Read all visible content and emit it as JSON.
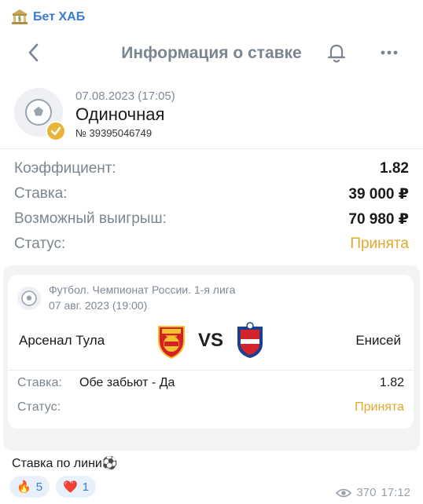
{
  "channel": {
    "name": "Бет ХАБ",
    "icon": "bank-icon"
  },
  "header": {
    "title": "Информация о ставке",
    "back_icon": "chevron-left-icon",
    "bell_icon": "bell-icon",
    "more_icon": "more-dots-icon"
  },
  "bet": {
    "date": "07.08.2023 (17:05)",
    "type": "Одиночная",
    "number": "№ 39395046749",
    "rows": [
      {
        "label": "Коэффициент:",
        "value": "1.82"
      },
      {
        "label": "Ставка:",
        "value": "39 000 ₽"
      },
      {
        "label": "Возможный выигрыш:",
        "value": "70 980 ₽"
      },
      {
        "label": "Статус:",
        "value": "Принята"
      }
    ]
  },
  "match": {
    "league": "Футбол. Чемпионат России. 1-я лига",
    "date": "07 авг. 2023 (19:00)",
    "team1": "Арсенал Тула",
    "vs": "VS",
    "team2": "Енисей",
    "stake_label": "Ставка:",
    "stake_value": "Обе забьют - Да",
    "stake_coef": "1.82",
    "status_label": "Статус:",
    "status_value": "Принята"
  },
  "post": {
    "caption": "Ставка по лини⚽",
    "reactions": [
      {
        "emoji": "🔥",
        "count": "5"
      },
      {
        "emoji": "❤️",
        "count": "1"
      }
    ],
    "views": "370",
    "time": "17:12"
  },
  "colors": {
    "accent": "#e0a82e",
    "link": "#3a7bd5",
    "muted": "#7a8692"
  }
}
